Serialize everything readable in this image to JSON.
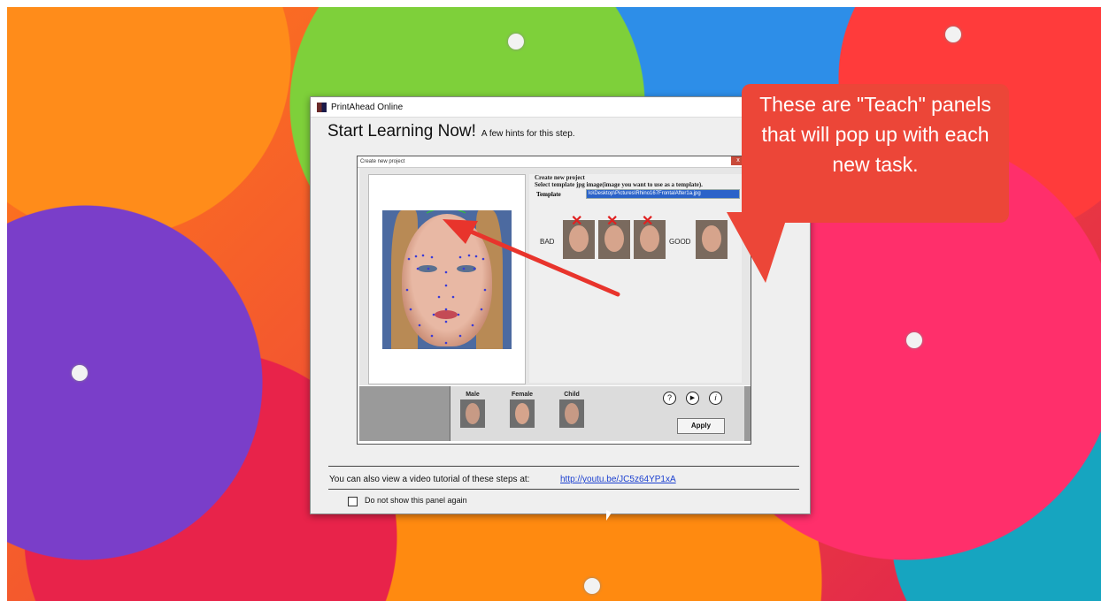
{
  "window": {
    "title": "PrintAhead Online",
    "headline": "Start Learning Now!",
    "headline_sub": "A few hints for this step."
  },
  "inner_dialog": {
    "title": "Create new project",
    "close_label": "x",
    "form_heading": "Create new project",
    "form_instruction": "Select template jpg image(image you want to use as a template).",
    "template_label": "Template",
    "template_value": "lo\\Desktop\\Pictures\\Rhino167FrontalAfter1a.jpg",
    "bad_label": "BAD",
    "good_label": "GOOD",
    "gender_options": [
      "Male",
      "Female",
      "Child"
    ],
    "apply_label": "Apply",
    "help_icons": [
      "?",
      "▶",
      "i"
    ]
  },
  "footer": {
    "video_text": "You can also view a video tutorial of these steps at:",
    "video_link": "http://youtu.be/JC5z64YP1xA",
    "dont_show_label": "Do not show this panel again"
  },
  "callout": {
    "text": "These are \"Teach\" panels that will pop up with each new task."
  },
  "colors": {
    "callout": "#ec4638",
    "arrow": "#e8342c",
    "selection": "#2b63c9",
    "link": "#1a3fd0"
  }
}
